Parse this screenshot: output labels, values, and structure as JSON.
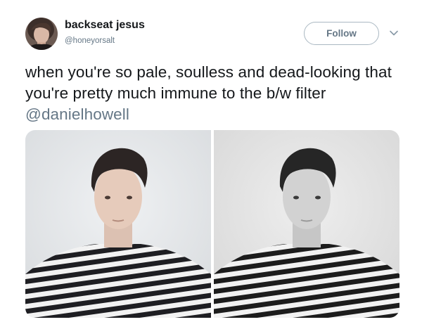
{
  "user": {
    "display_name": "backseat jesus",
    "handle": "@honeyorsalt"
  },
  "actions": {
    "follow_label": "Follow"
  },
  "tweet": {
    "text": "when you're so pale, soulless and dead-looking that you're pretty much immune to the b/w filter",
    "mention": "@danielhowell"
  },
  "icons": {
    "caret": "chevron-down-icon"
  },
  "colors": {
    "text": "#14171a",
    "secondary": "#657786",
    "border": "#aab8c2"
  }
}
